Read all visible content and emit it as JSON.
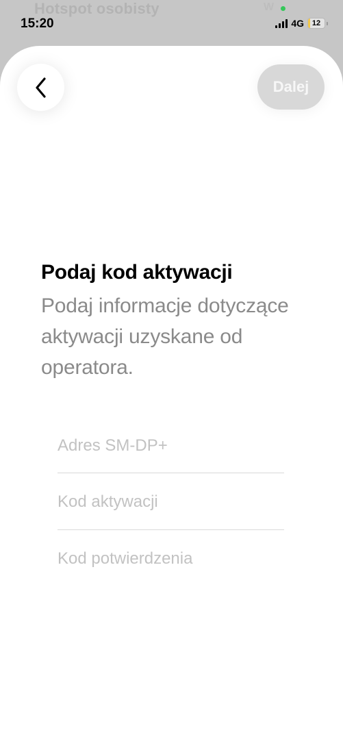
{
  "background": {
    "title": "Hotspot osobisty",
    "wifi_label": "W"
  },
  "status_bar": {
    "time": "15:20",
    "network": "4G",
    "battery": "12",
    "battery_level": 0.12
  },
  "nav": {
    "back_icon": "chevron-left-icon",
    "next_label": "Dalej"
  },
  "content": {
    "title": "Podaj kod aktywacji",
    "subtitle": "Podaj informacje dotyczące aktywacji uzyskane od operatora."
  },
  "form": {
    "fields": [
      {
        "placeholder": "Adres SM-DP+",
        "value": ""
      },
      {
        "placeholder": "Kod aktywacji",
        "value": ""
      },
      {
        "placeholder": "Kod potwierdzenia",
        "value": ""
      }
    ]
  },
  "colors": {
    "accent_disabled": "#d8d8d8",
    "signal_green": "#34c759",
    "battery_yellow": "#f3c84a"
  }
}
